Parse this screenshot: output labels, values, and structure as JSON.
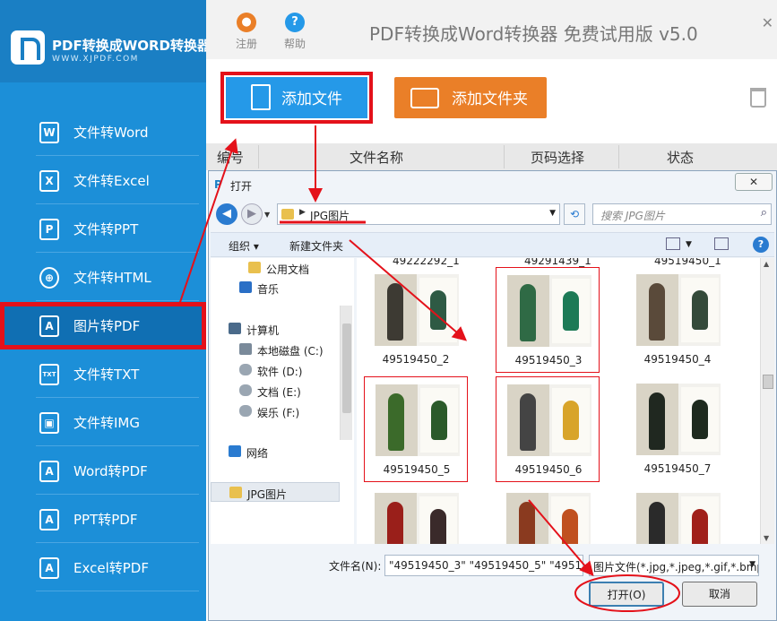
{
  "brand": {
    "name": "PDF转换成WORD转换器",
    "url": "WWW.XJPDF.COM"
  },
  "app_title": "PDF转换成Word转换器 免费试用版 v5.0",
  "topbar": {
    "register": "注册",
    "help": "帮助"
  },
  "nav_items": [
    {
      "label": "文件转Word",
      "icon": "word-icon",
      "glyph": "W"
    },
    {
      "label": "文件转Excel",
      "icon": "excel-icon",
      "glyph": "X"
    },
    {
      "label": "文件转PPT",
      "icon": "ppt-icon",
      "glyph": "P"
    },
    {
      "label": "文件转HTML",
      "icon": "globe-icon",
      "glyph": "⊕"
    },
    {
      "label": "图片转PDF",
      "icon": "pdf-icon",
      "glyph": "A",
      "active": true
    },
    {
      "label": "文件转TXT",
      "icon": "txt-icon",
      "glyph": "TXT"
    },
    {
      "label": "文件转IMG",
      "icon": "image-icon",
      "glyph": "▣"
    },
    {
      "label": "Word转PDF",
      "icon": "pdf-icon",
      "glyph": "A"
    },
    {
      "label": "PPT转PDF",
      "icon": "pdf-icon",
      "glyph": "A"
    },
    {
      "label": "Excel转PDF",
      "icon": "pdf-icon",
      "glyph": "A"
    }
  ],
  "toolbar": {
    "add_file": "添加文件",
    "add_folder": "添加文件夹"
  },
  "table_headers": {
    "num": "编号",
    "name": "文件名称",
    "pages": "页码选择",
    "status": "状态"
  },
  "dialog": {
    "title": "打开",
    "address": "JPG图片",
    "search_placeholder": "搜索 JPG图片",
    "organize": "组织 ▾",
    "new_folder": "新建文件夹",
    "tree": [
      {
        "label": "公用文档",
        "icon": "folder-icon"
      },
      {
        "label": "音乐",
        "icon": "music-icon"
      },
      {
        "label": "计算机",
        "icon": "computer-icon"
      },
      {
        "label": "本地磁盘 (C:)",
        "icon": "windows-drive-icon"
      },
      {
        "label": "软件 (D:)",
        "icon": "drive-icon"
      },
      {
        "label": "文档 (E:)",
        "icon": "drive-icon"
      },
      {
        "label": "娱乐 (F:)",
        "icon": "drive-icon"
      },
      {
        "label": "网络",
        "icon": "network-icon"
      },
      {
        "label": "JPG图片",
        "icon": "folder-icon"
      }
    ],
    "top_captions": [
      "49222292_1",
      "49291439_1",
      "49519450_1"
    ],
    "thumbnails": [
      {
        "name": "49519450_2",
        "selected": false,
        "c1": "#3d3a33",
        "c2": "#2e5a44"
      },
      {
        "name": "49519450_3",
        "selected": true,
        "c1": "#2f6a45",
        "c2": "#1d7a56"
      },
      {
        "name": "49519450_4",
        "selected": false,
        "c1": "#5a4a3a",
        "c2": "#344a3a"
      },
      {
        "name": "49519450_5",
        "selected": true,
        "c1": "#3b6a2a",
        "c2": "#2b5a2a"
      },
      {
        "name": "49519450_6",
        "selected": true,
        "c1": "#444444",
        "c2": "#d8a42a"
      },
      {
        "name": "49519450_7",
        "selected": false,
        "c1": "#202820",
        "c2": "#1e2a1e"
      },
      {
        "name": "",
        "selected": false,
        "c1": "#9a1f1a",
        "c2": "#3a2a2a"
      },
      {
        "name": "",
        "selected": false,
        "c1": "#8a3a1f",
        "c2": "#c0501f"
      },
      {
        "name": "",
        "selected": false,
        "c1": "#2a2a2a",
        "c2": "#a0201a"
      }
    ],
    "filename_label": "文件名(N):",
    "filename_value": "\"49519450_3\" \"49519450_5\" \"4951",
    "filetype_value": "图片文件(*.jpg,*.jpeg,*.gif,*.bmp)",
    "open_button": "打开(O)",
    "cancel_button": "取消"
  },
  "colors": {
    "sidebar": "#1c8fd8",
    "highlight": "#e4111a",
    "add_file": "#2599e8",
    "add_folder": "#ea7f28"
  }
}
